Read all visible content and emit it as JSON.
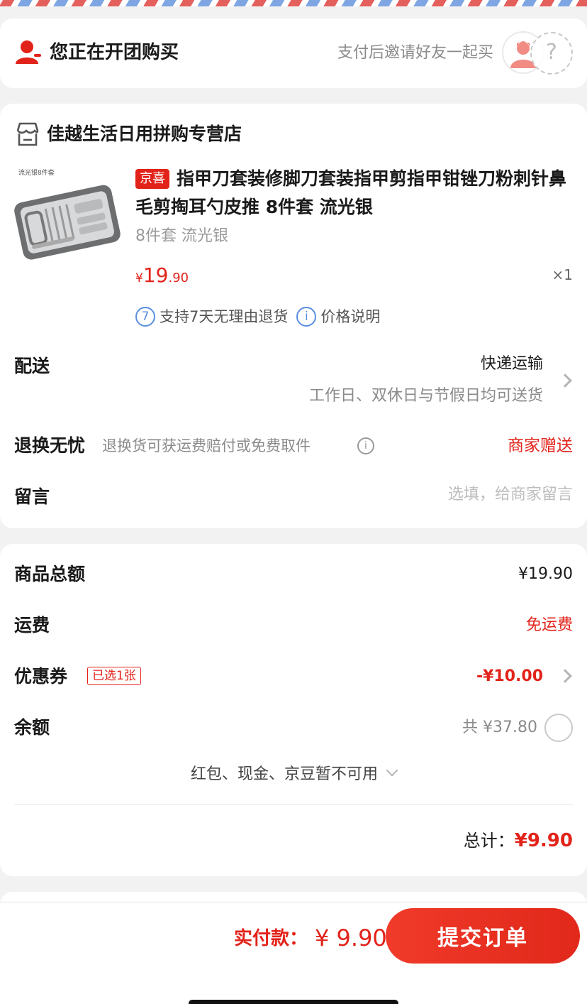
{
  "colors": {
    "accent": "#e2231a",
    "info": "#5b8fe0"
  },
  "group": {
    "title": "您正在开团购买",
    "hint": "支付后邀请好友一起买",
    "placeholder_symbol": "?"
  },
  "store": {
    "name": "佳越生活日用拼购专营店"
  },
  "product": {
    "image_caption": "流光银8件套",
    "badge": "京喜",
    "title": "指甲刀套装修脚刀套装指甲剪指甲钳锉刀粉刺针鼻毛剪掏耳勺皮推 8件套 流光银",
    "spec": "8件套 流光银",
    "price_symbol": "¥",
    "price_int": "19",
    "price_dec": ".90",
    "quantity": "×1",
    "tag1_icon": "7",
    "tag1_text": "支持7天无理由退货",
    "tag2_icon": "i",
    "tag2_text": "价格说明"
  },
  "delivery": {
    "label": "配送",
    "method": "快递运输",
    "desc": "工作日、双休日与节假日均可送货"
  },
  "returns": {
    "label": "退换无忧",
    "desc": "退换货可获运费赔付或免费取件",
    "info_icon": "i",
    "gift": "商家赠送"
  },
  "message": {
    "label": "留言",
    "placeholder": "选填，给商家留言"
  },
  "summary": {
    "goods_label": "商品总额",
    "goods_value": "¥19.90",
    "shipping_label": "运费",
    "shipping_value": "免运费",
    "coupon_label": "优惠券",
    "coupon_tag": "已选1张",
    "coupon_value": "-¥10.00",
    "balance_label": "余额",
    "balance_value": "共 ¥37.80",
    "unavailable": "红包、现金、京豆暂不可用",
    "total_label": "总计：",
    "total_value": "¥9.90"
  },
  "footer": {
    "pay_label": "实付款：",
    "pay_value": "¥ 9.90",
    "submit": "提交订单"
  }
}
